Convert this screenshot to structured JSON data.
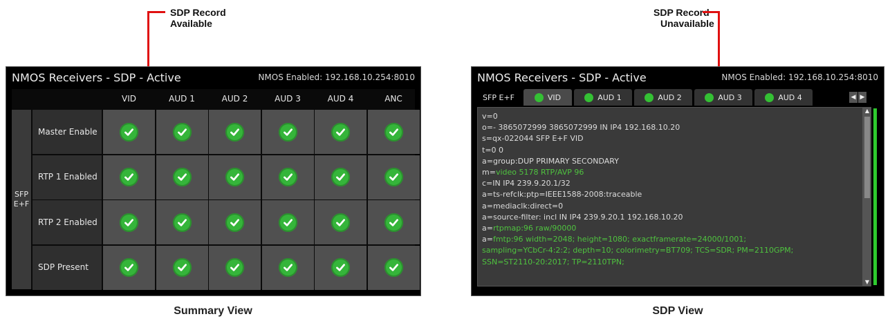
{
  "callouts": {
    "left_line1": "SDP Record",
    "left_line2": "Available",
    "right_line1": "SDP Record",
    "right_line2": "Unavailable"
  },
  "captions": {
    "left": "Summary View",
    "right": "SDP View"
  },
  "summary": {
    "title": "NMOS Receivers - SDP - Active",
    "status": "NMOS Enabled: 192.168.10.254:8010",
    "columns": [
      "VID",
      "AUD 1",
      "AUD 2",
      "AUD 3",
      "AUD 4",
      "ANC"
    ],
    "group_label": "SFP E+F",
    "rows": [
      {
        "label": "Master Enable",
        "values": [
          true,
          true,
          true,
          true,
          true,
          true
        ]
      },
      {
        "label": "RTP 1 Enabled",
        "values": [
          true,
          true,
          true,
          true,
          true,
          true
        ]
      },
      {
        "label": "RTP 2 Enabled",
        "values": [
          true,
          true,
          true,
          true,
          true,
          true
        ]
      },
      {
        "label": "SDP Present",
        "values": [
          true,
          true,
          true,
          true,
          true,
          true
        ]
      }
    ],
    "check_color": "#35b53a"
  },
  "sdp": {
    "title": "NMOS Receivers - SDP - Active",
    "status": "NMOS Enabled: 192.168.10.254:8010",
    "tabs": [
      {
        "label": "SFP E+F",
        "dot": false,
        "selected": false
      },
      {
        "label": "VID",
        "dot": true,
        "selected": true
      },
      {
        "label": "AUD 1",
        "dot": true,
        "selected": false
      },
      {
        "label": "AUD 2",
        "dot": true,
        "selected": false
      },
      {
        "label": "AUD 3",
        "dot": true,
        "selected": false
      },
      {
        "label": "AUD 4",
        "dot": true,
        "selected": false
      }
    ],
    "lines": [
      {
        "text": "v=0",
        "green": false
      },
      {
        "text": "o=- 3865072999 3865072999 IN IP4 192.168.10.20",
        "green": false
      },
      {
        "text": "s=qx-022044 SFP E+F VID",
        "green": false
      },
      {
        "text": "t=0 0",
        "green": false
      },
      {
        "text": "a=group:DUP PRIMARY SECONDARY",
        "green": false
      },
      {
        "prefix": "m=",
        "text": "video 5178 RTP/AVP 96",
        "green": true
      },
      {
        "text": "c=IN IP4 239.9.20.1/32",
        "green": false
      },
      {
        "text": "a=ts-refclk:ptp=IEEE1588-2008:traceable",
        "green": false
      },
      {
        "text": "a=mediaclk:direct=0",
        "green": false
      },
      {
        "text": "a=source-filter: incl IN IP4 239.9.20.1 192.168.10.20",
        "green": false
      },
      {
        "prefix": "a=",
        "text": "rtpmap:96 raw/90000",
        "green": true
      },
      {
        "prefix": "a=",
        "text": "fmtp:96 width=2048; height=1080; exactframerate=24000/1001;",
        "green": true
      },
      {
        "text": "sampling=YCbCr-4:2:2; depth=10; colorimetry=BT709; TCS=SDR; PM=2110GPM;",
        "green": true
      },
      {
        "text": "SSN=ST2110-20:2017; TP=2110TPN;",
        "green": true
      }
    ],
    "accent_green": "#4fc33f"
  }
}
